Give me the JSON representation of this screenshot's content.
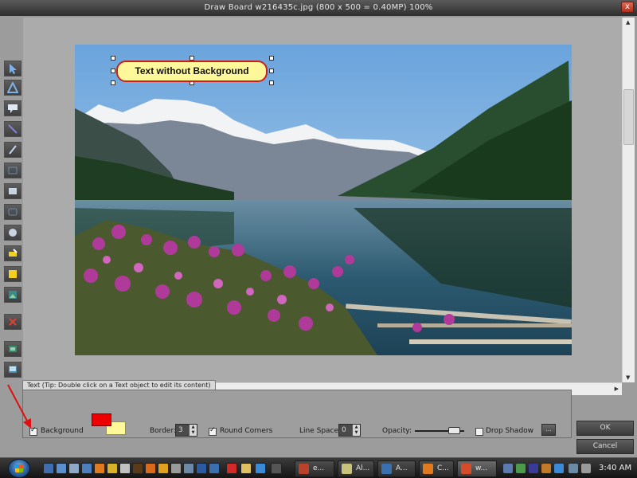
{
  "window": {
    "title": "Draw Board    w216435c.jpg   (800 x 500 = 0.40MP)     100%",
    "close_label": "x"
  },
  "toolbar": {
    "tools": [
      {
        "name": "pointer-tool",
        "icon": "pointer-icon"
      },
      {
        "name": "arrow-tool",
        "icon": "arrow-icon"
      },
      {
        "name": "callout-tool",
        "icon": "callout-icon"
      },
      {
        "name": "line-tool",
        "icon": "line-icon"
      },
      {
        "name": "pencil-tool",
        "icon": "pencil-icon"
      },
      {
        "name": "rectangle-tool",
        "icon": "rectangle-icon"
      },
      {
        "name": "filled-rectangle-tool",
        "icon": "filled-rectangle-icon"
      },
      {
        "name": "rounded-rectangle-tool",
        "icon": "rounded-rectangle-icon"
      },
      {
        "name": "ellipse-tool",
        "icon": "ellipse-icon"
      },
      {
        "name": "highlighter-tool",
        "icon": "highlighter-icon"
      },
      {
        "name": "fill-tool",
        "icon": "fill-icon"
      },
      {
        "name": "image-tool",
        "icon": "image-icon"
      },
      {
        "name": "delete-tool",
        "icon": "delete-icon"
      },
      {
        "name": "crop-tool",
        "icon": "crop-icon"
      },
      {
        "name": "screen-tool",
        "icon": "screen-icon"
      }
    ]
  },
  "canvas": {
    "text_object": "Text without Background"
  },
  "panel": {
    "tab_label": "Text (Tip: Double click on a Text object to edit its content)",
    "background_label": "Background",
    "background_checked": true,
    "foreground_color": "#ee0000",
    "background_color": "#fff99a",
    "border_label": "Border:",
    "border_value": "3",
    "round_corners_label": "Round Corners",
    "round_corners_checked": true,
    "line_space_label": "Line Space:",
    "line_space_value": "0",
    "opacity_label": "Opacity:",
    "opacity_level": 0.8,
    "drop_shadow_label": "Drop Shadow",
    "drop_shadow_checked": false,
    "more_label": "..."
  },
  "dialog": {
    "ok_label": "OK",
    "cancel_label": "Cancel"
  },
  "taskbar": {
    "tasks": [
      {
        "label": "e...",
        "color": "#b8422a"
      },
      {
        "label": "Al...",
        "color": "#c9c27a"
      },
      {
        "label": "A...",
        "color": "#3a6fb0"
      },
      {
        "label": "C...",
        "color": "#e07a1f"
      },
      {
        "label": "w...",
        "color": "#d64b2a"
      }
    ],
    "clock": "3:40 AM"
  }
}
